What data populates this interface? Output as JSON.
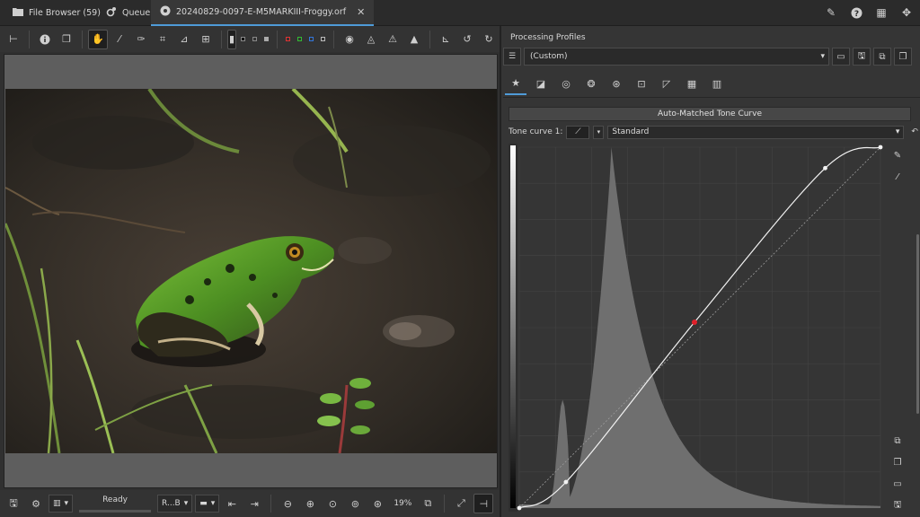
{
  "tabs": [
    {
      "icon": "folder-icon",
      "label": "File Browser (59)"
    },
    {
      "icon": "queue-icon",
      "label": "Queue"
    },
    {
      "icon": "aperture-icon",
      "label": "20240829-0097-E-M5MARKIII-Froggy.orf"
    }
  ],
  "bottom": {
    "status": "Ready",
    "channel": "R...B",
    "zoom": "19%"
  },
  "panel": {
    "title": "Processing Profiles",
    "profile": "(Custom)",
    "automatch_label": "Auto-Matched Tone Curve",
    "tone_curve_label": "Tone curve 1:",
    "curve_mode": "Standard"
  },
  "colors": {
    "accent": "#4f9bd8",
    "histogram": "#6f6f6f",
    "curve": "#f2f2f2",
    "cursor_point": "#e0202a"
  },
  "curve_data": {
    "type": "area",
    "histogram_peak_x": 0.255,
    "control_points": [
      [
        0.0,
        0.0
      ],
      [
        0.129,
        0.072
      ],
      [
        0.485,
        0.515
      ],
      [
        0.847,
        0.942
      ],
      [
        1.0,
        1.0
      ]
    ],
    "highlighted_point": [
      0.485,
      0.515
    ]
  }
}
